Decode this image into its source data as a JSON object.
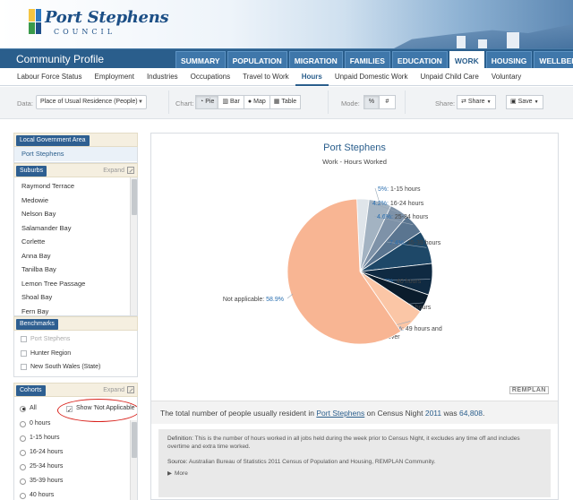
{
  "header": {
    "logo_name": "Port Stephens",
    "logo_sub": "COUNCIL",
    "site_title": "Community Profile"
  },
  "main_tabs": [
    "SUMMARY",
    "POPULATION",
    "MIGRATION",
    "FAMILIES",
    "EDUCATION",
    "WORK",
    "HOUSING",
    "WELLBEING"
  ],
  "main_tab_active": "WORK",
  "sub_nav": [
    "Labour Force Status",
    "Employment",
    "Industries",
    "Occupations",
    "Travel to Work",
    "Hours",
    "Unpaid Domestic Work",
    "Unpaid Child Care",
    "Voluntary"
  ],
  "sub_nav_active": "Hours",
  "toolbar": {
    "data_label": "Data:",
    "data_value": "Place of Usual Residence (People)",
    "chart_label": "Chart:",
    "chart_buttons": [
      "Pie",
      "Bar",
      "Map",
      "Table"
    ],
    "mode_label": "Mode:",
    "mode_buttons": [
      "%",
      "#"
    ],
    "share_label": "Share:",
    "share_button": "Share",
    "save_button": "Save"
  },
  "sidebar": {
    "lga": {
      "title": "Local Government Area",
      "item": "Port Stephens"
    },
    "suburbs": {
      "title": "Suburbs",
      "expand": "Expand",
      "items": [
        "Raymond Terrace",
        "Medowie",
        "Nelson Bay",
        "Salamander Bay",
        "Corlette",
        "Anna Bay",
        "Tanilba Bay",
        "Lemon Tree Passage",
        "Shoal Bay",
        "Fern Bay"
      ]
    },
    "benchmarks": {
      "title": "Benchmarks",
      "items": [
        "Port Stephens",
        "Hunter Region",
        "New South Wales (State)"
      ]
    },
    "cohorts": {
      "title": "Cohorts",
      "expand": "Expand",
      "all_label": "All",
      "show_na_label": "Show 'Not Applicable'",
      "items": [
        "0 hours",
        "1-15 hours",
        "16-24 hours",
        "25-34 hours",
        "35-39 hours",
        "40 hours"
      ]
    }
  },
  "chart_data": {
    "type": "pie",
    "title": "Port Stephens",
    "subtitle": "Work - Hours Worked",
    "slices": [
      {
        "label": "1-15 hours",
        "value": 5,
        "display": "5%",
        "color": "#a3b3c2"
      },
      {
        "label": "16-24 hours",
        "value": 4.2,
        "display": "4.2%",
        "color": "#7e92a8"
      },
      {
        "label": "25-34 hours",
        "value": 4.6,
        "display": "4.6%",
        "color": "#5a7590"
      },
      {
        "label": "35-39 hours",
        "value": 7.4,
        "display": "7.4%",
        "color": "#1e4868"
      },
      {
        "label": "40 hours",
        "value": 7,
        "display": "7%",
        "color": "#0f2a42"
      },
      {
        "label": "41-48 hours",
        "value": 4.1,
        "display": "4.1%",
        "color": "#0a1c2c"
      },
      {
        "label": "49 hours and over",
        "value": 6.1,
        "display": "6.1%",
        "color": "#fbc6a6"
      },
      {
        "label": "Not applicable",
        "value": 58.9,
        "display": "58.9%",
        "color": "#f8b593"
      },
      {
        "label": "0 hours",
        "value": 2.7,
        "display": "",
        "color": "#dfe5ea"
      }
    ]
  },
  "brand_mark": "REMPLAN",
  "summary": {
    "prefix": "The total number of people usually resident in",
    "place": "Port Stephens",
    "middle": "on Census Night",
    "year": "2011",
    "was": "was",
    "total": "64,808",
    "end": "."
  },
  "definition": {
    "label": "Definition:",
    "text": "This is the number of hours worked in all jobs held during the week prior to Census Night, it excludes any time off and includes overtime and extra time worked.",
    "source_label": "Source:",
    "source_text": "Australian Bureau of Statistics 2011 Census of Population and Housing, REMPLAN Community.",
    "more": "More"
  },
  "colors": {
    "nav": "#2a5e8c",
    "accent": "#2e5f91",
    "highlight_oval": "#d9231d"
  }
}
